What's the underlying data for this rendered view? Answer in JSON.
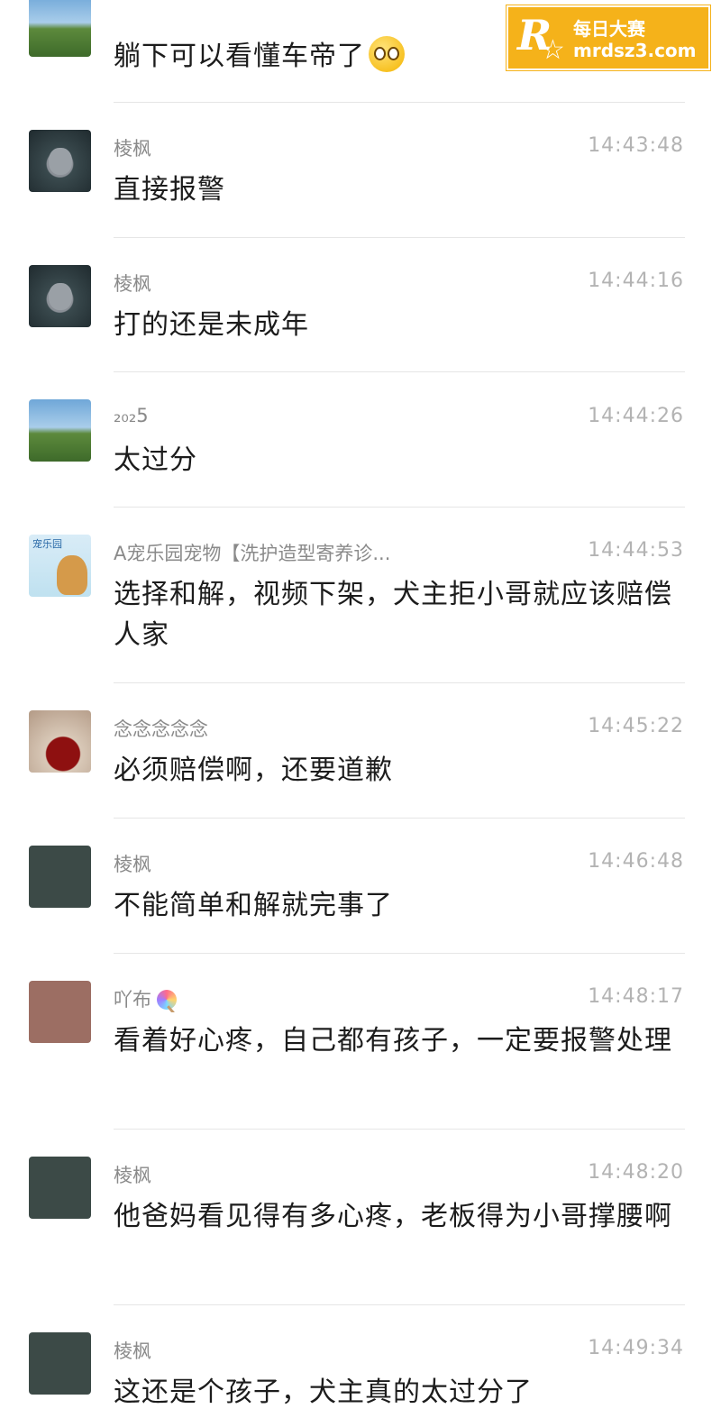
{
  "watermark": {
    "brand_cn": "每日大赛",
    "brand_url": "mrdsz3.com"
  },
  "messages": [
    {
      "avatar": "landscape-avatar",
      "name": "",
      "time": "",
      "text": "躺下可以看懂车帝了",
      "emoji": "flushed-face"
    },
    {
      "avatar": "kitten-avatar",
      "name": "棱枫",
      "time": "14:43:48",
      "text": "直接报警"
    },
    {
      "avatar": "kitten-avatar",
      "name": "棱枫",
      "time": "14:44:16",
      "text": "打的还是未成年"
    },
    {
      "avatar": "landscape-avatar",
      "name": "₂₀₂5",
      "time": "14:44:26",
      "text": "太过分"
    },
    {
      "avatar": "pet-shop-avatar",
      "avatar_text": "宠乐园",
      "name": "A宠乐园宠物【洗护造型寄养诊...",
      "time": "14:44:53",
      "text": "选择和解，视频下架，犬主拒小哥就应该赔偿人家"
    },
    {
      "avatar": "woman-avatar",
      "name": "念念念念念",
      "time": "14:45:22",
      "text": "必须赔偿啊，还要道歉"
    },
    {
      "avatar": "dark-square-avatar",
      "name": "棱枫",
      "time": "14:46:48",
      "text": "不能简单和解就完事了"
    },
    {
      "avatar": "brown-square-avatar",
      "name": "吖布",
      "name_icon": "lollipop-icon",
      "time": "14:48:17",
      "text": "看着好心疼，自己都有孩子，一定要报警处理"
    },
    {
      "avatar": "dark-square-avatar",
      "name": "棱枫",
      "time": "14:48:20",
      "text": "他爸妈看见得有多心疼，老板得为小哥撑腰啊"
    },
    {
      "avatar": "dark-square-avatar",
      "name": "棱枫",
      "time": "14:49:34",
      "text": "这还是个孩子，犬主真的太过分了"
    }
  ]
}
